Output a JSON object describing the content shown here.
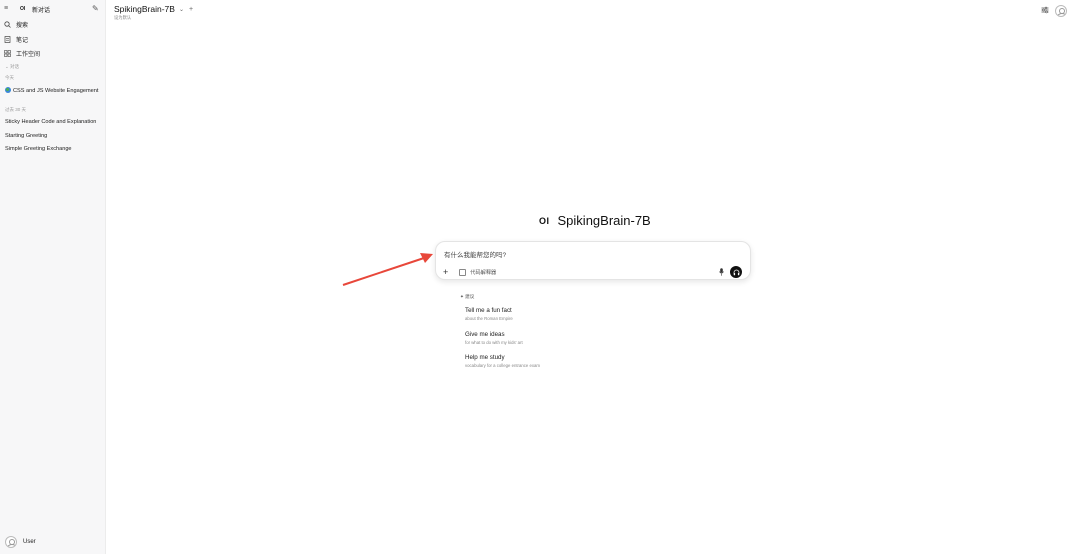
{
  "sidebar": {
    "app_logo": "OI",
    "new_chat_label": "新对话",
    "nav": [
      {
        "label": "搜索",
        "icon": "search-icon"
      },
      {
        "label": "笔记",
        "icon": "notes-icon"
      },
      {
        "label": "工作空间",
        "icon": "workspace-icon"
      }
    ],
    "section_chats_label": "对话",
    "today_label": "今天",
    "today_chats": [
      "CSS and JS Website Engagement"
    ],
    "past30_label": "过去 30 天",
    "past30_chats": [
      "Sticky Header Code and Explanation",
      "Starting Greeting",
      "Simple Greeting Exchange"
    ],
    "user_name": "User"
  },
  "header": {
    "model_name": "SpikingBrain-7B",
    "set_default_label": "设为默认"
  },
  "main": {
    "logo": "OI",
    "model_title": "SpikingBrain-7B",
    "input_placeholder": "有什么我能帮您的吗?",
    "code_interpreter_label": "代码解释器",
    "suggestions_label": "建议",
    "suggestions": [
      {
        "title": "Tell me a fun fact",
        "subtitle": "about the Roman Empire"
      },
      {
        "title": "Give me ideas",
        "subtitle": "for what to do with my kids' art"
      },
      {
        "title": "Help me study",
        "subtitle": "vocabulary for a college entrance exam"
      }
    ]
  },
  "colors": {
    "sidebar_bg": "#f7f7f8",
    "annotation_arrow": "#e8473a",
    "voice_button": "#111111"
  }
}
